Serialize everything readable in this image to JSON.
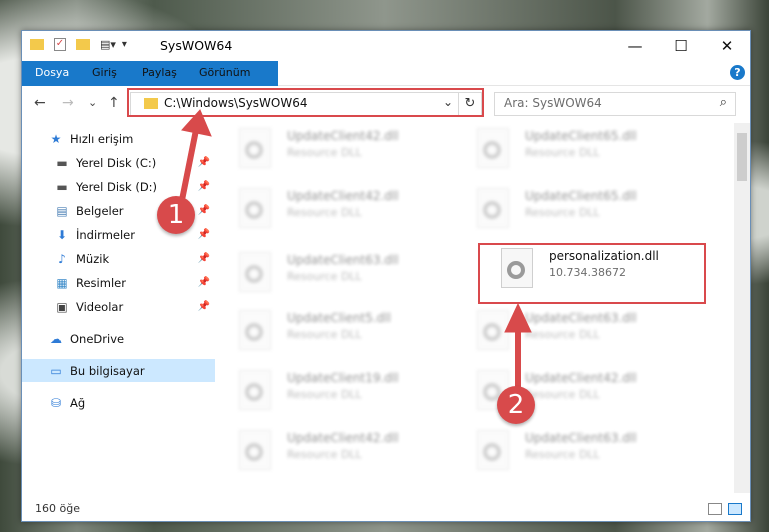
{
  "window": {
    "title": "SysWOW64",
    "minimize": "—",
    "maximize": "☐",
    "close": "✕"
  },
  "ribbon": {
    "tabs": [
      "Dosya",
      "Giriş",
      "Paylaş",
      "Görünüm"
    ],
    "help": "?"
  },
  "nav": {
    "back": "←",
    "forward": "→",
    "recent": "⌄",
    "up": "↑",
    "address": "C:\\Windows\\SysWOW64",
    "dropdown": "⌄",
    "refresh": "↻",
    "search_placeholder": "Ara: SysWOW64",
    "search_icon": "⌕"
  },
  "sidebar": {
    "items": [
      {
        "label": "Hızlı erişim",
        "icon": "★",
        "pinned": false
      },
      {
        "label": "Yerel Disk (C:)",
        "icon": "▬",
        "pinned": true
      },
      {
        "label": "Yerel Disk (D:)",
        "icon": "▬",
        "pinned": true
      },
      {
        "label": "Belgeler",
        "icon": "▤",
        "pinned": true
      },
      {
        "label": "İndirmeler",
        "icon": "⬇",
        "pinned": true
      },
      {
        "label": "Müzik",
        "icon": "♪",
        "pinned": true
      },
      {
        "label": "Resimler",
        "icon": "▦",
        "pinned": true
      },
      {
        "label": "Videolar",
        "icon": "▣",
        "pinned": true
      },
      {
        "label": "OneDrive",
        "icon": "☁",
        "pinned": false
      },
      {
        "label": "Bu bilgisayar",
        "icon": "▭",
        "pinned": false
      },
      {
        "label": "Ağ",
        "icon": "⛁",
        "pinned": false
      }
    ],
    "pin_glyph": "📌"
  },
  "files": {
    "highlight": {
      "name": "personalization.dll",
      "version": "10.734.38672"
    },
    "left": [
      {
        "name": "UpdateClient42.dll",
        "type": "Resource DLL"
      },
      {
        "name": "UpdateClient42.dll",
        "type": "Resource DLL"
      },
      {
        "name": "UpdateClient63.dll",
        "type": "Resource DLL"
      },
      {
        "name": "UpdateClient5.dll",
        "type": "Resource DLL"
      },
      {
        "name": "UpdateClient19.dll",
        "type": "Resource DLL"
      },
      {
        "name": "UpdateClient42.dll",
        "type": "Resource DLL"
      }
    ],
    "right": [
      {
        "name": "UpdateClient65.dll",
        "type": "Resource DLL"
      },
      {
        "name": "UpdateClient65.dll",
        "type": "Resource DLL"
      },
      {
        "name": "UpdateClient63.dll",
        "type": "Resource DLL"
      },
      {
        "name": "UpdateClient42.dll",
        "type": "Resource DLL"
      },
      {
        "name": "UpdateClient63.dll",
        "type": "Resource DLL"
      }
    ]
  },
  "status": {
    "count": "160 öğe"
  },
  "callouts": {
    "one": "1",
    "two": "2"
  },
  "colors": {
    "accent": "#1979ca",
    "highlight": "#d9494c"
  }
}
